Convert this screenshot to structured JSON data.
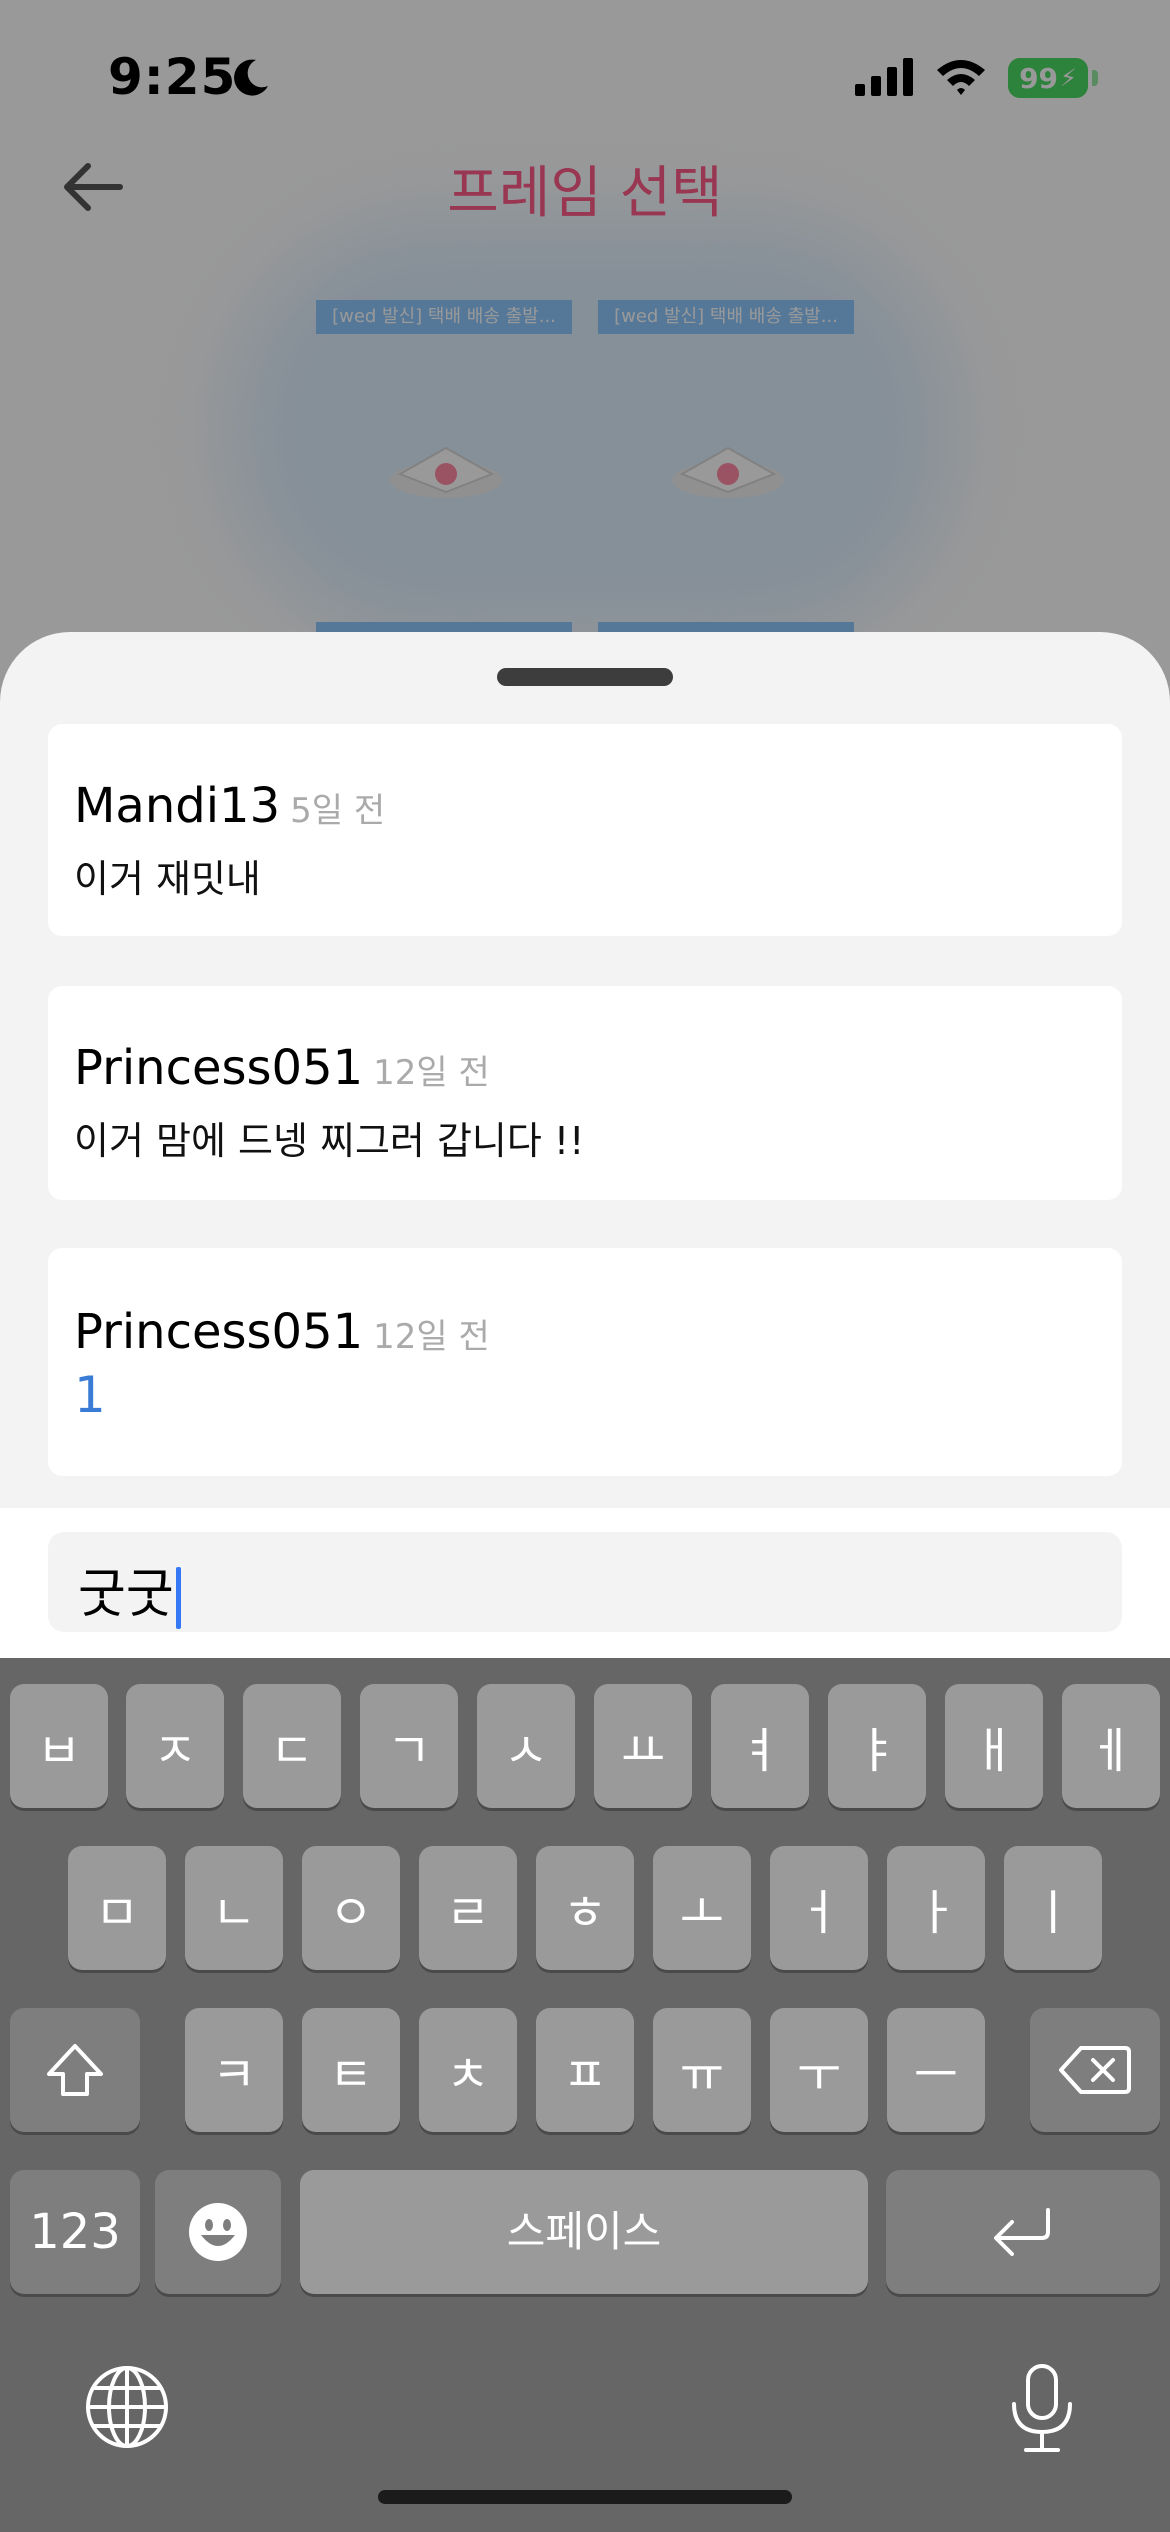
{
  "status_bar": {
    "time": "9:25",
    "battery": "99"
  },
  "header": {
    "title": "프레임 선택"
  },
  "frames": [
    {
      "label": "[wed 발신] 택배 배송 출발..."
    },
    {
      "label": "[wed 발신] 택배 배송 출발..."
    }
  ],
  "comments": [
    {
      "author": "Mandi13",
      "time": "5일 전",
      "text": "이거 재밋내"
    },
    {
      "author": "Princess051",
      "time": "12일 전",
      "text": "이거 맘에 드넹 찌그러 갑니다 !!"
    },
    {
      "author": "Princess051",
      "time": "12일 전",
      "text": "1"
    }
  ],
  "input": {
    "value": "굿굿"
  },
  "keyboard": {
    "row1": [
      "ㅂ",
      "ㅈ",
      "ㄷ",
      "ㄱ",
      "ㅅ",
      "ㅛ",
      "ㅕ",
      "ㅑ",
      "ㅐ",
      "ㅔ"
    ],
    "row2": [
      "ㅁ",
      "ㄴ",
      "ㅇ",
      "ㄹ",
      "ㅎ",
      "ㅗ",
      "ㅓ",
      "ㅏ",
      "ㅣ"
    ],
    "row3": [
      "ㅋ",
      "ㅌ",
      "ㅊ",
      "ㅍ",
      "ㅠ",
      "ㅜ",
      "ㅡ"
    ],
    "numbers_label": "123",
    "space_label": "스페이스",
    "icons": [
      "shift-icon",
      "backspace-icon",
      "emoji-icon",
      "return-icon",
      "globe-icon",
      "microphone-icon"
    ]
  },
  "colors": {
    "title": "#ff5a88",
    "link": "#3a7bd5",
    "battery": "#4cd964",
    "caret": "#3478f6"
  }
}
